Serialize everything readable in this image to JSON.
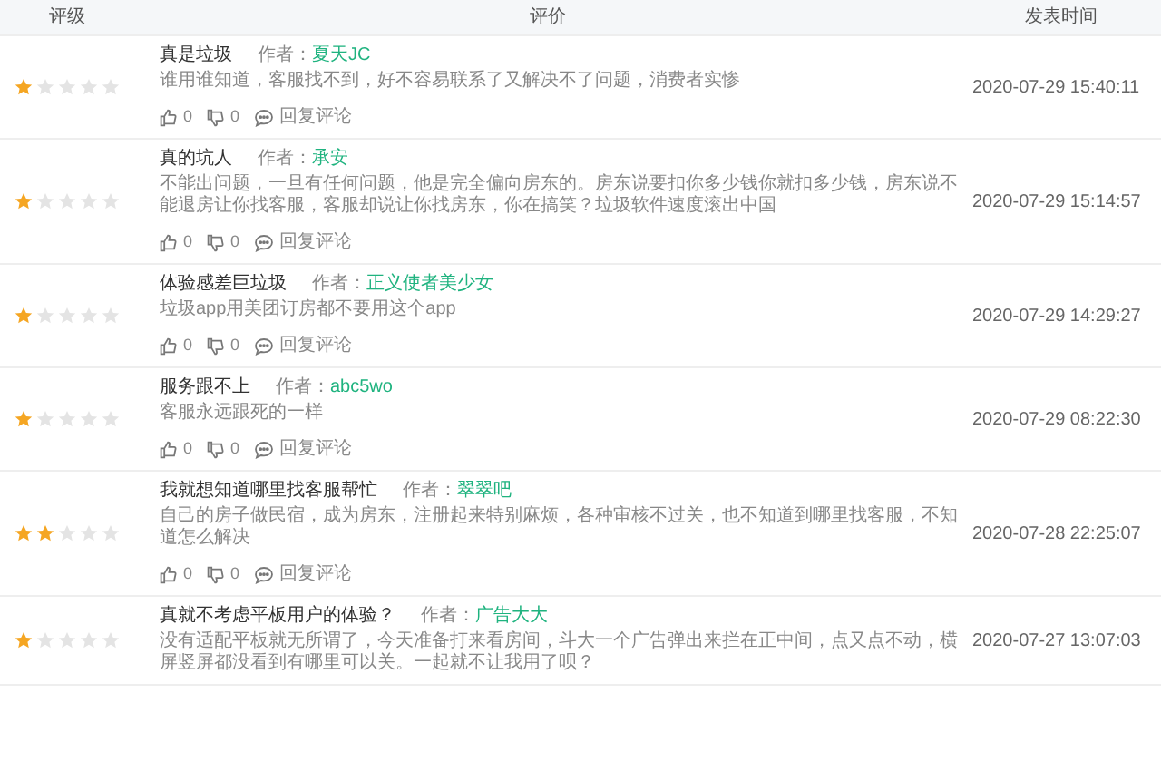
{
  "table": {
    "columns": [
      "评级",
      "评价",
      "发表时间"
    ],
    "rows": [
      {
        "stars": 1,
        "title": "真是垃圾",
        "author_label": "作者：",
        "author": "夏天JC",
        "body": "谁用谁知道，客服找不到，好不容易联系了又解决不了问题，消费者实惨",
        "likes": "0",
        "dislikes": "0",
        "reply": "回复评论",
        "date": "2020-07-29 15:40:11"
      },
      {
        "stars": 1,
        "title": "真的坑人",
        "author_label": "作者：",
        "author": "承安",
        "body": "不能出问题，一旦有任何问题，他是完全偏向房东的。房东说要扣你多少钱你就扣多少钱，房东说不能退房让你找客服，客服却说让你找房东，你在搞笑？垃圾软件速度滚出中国",
        "likes": "0",
        "dislikes": "0",
        "reply": "回复评论",
        "date": "2020-07-29 15:14:57"
      },
      {
        "stars": 1,
        "title": "体验感差巨垃圾",
        "author_label": "作者：",
        "author": "正义使者美少女",
        "body": "垃圾app用美团订房都不要用这个app",
        "likes": "0",
        "dislikes": "0",
        "reply": "回复评论",
        "date": "2020-07-29 14:29:27"
      },
      {
        "stars": 1,
        "title": "服务跟不上",
        "author_label": "作者：",
        "author": "abc5wo",
        "body": "客服永远跟死的一样",
        "likes": "0",
        "dislikes": "0",
        "reply": "回复评论",
        "date": "2020-07-29 08:22:30"
      },
      {
        "stars": 2,
        "title": "我就想知道哪里找客服帮忙",
        "author_label": "作者：",
        "author": "翠翠吧",
        "body": "自己的房子做民宿，成为房东，注册起来特别麻烦，各种审核不过关，也不知道到哪里找客服，不知道怎么解决",
        "likes": "0",
        "dislikes": "0",
        "reply": "回复评论",
        "date": "2020-07-28 22:25:07"
      },
      {
        "stars": 1,
        "title": "真就不考虑平板用户的体验？",
        "author_label": "作者：",
        "author": "广告大大",
        "body": "没有适配平板就无所谓了，今天准备打来看房间，斗大一个广告弹出来拦在正中间，点又点不动，横屏竖屏都没看到有哪里可以关。一起就不让我用了呗？",
        "date": "2020-07-27 13:07:03"
      }
    ]
  }
}
